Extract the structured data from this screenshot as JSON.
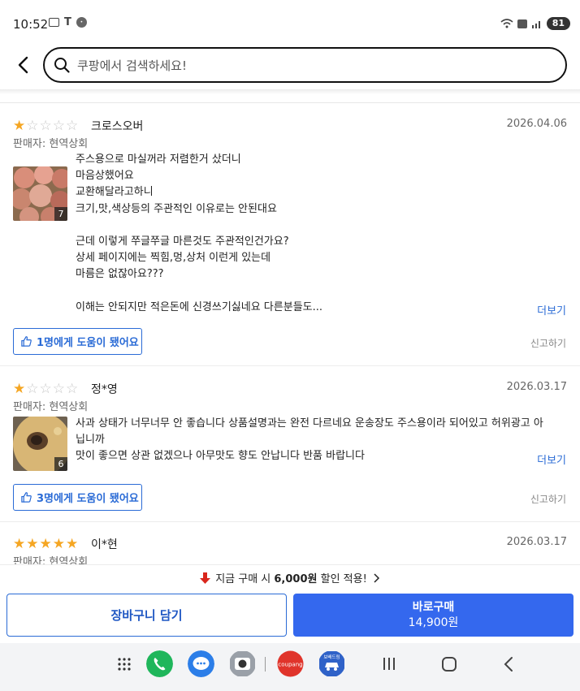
{
  "status_bar": {
    "time": "10:52",
    "battery": "81",
    "network": "LTE"
  },
  "search": {
    "placeholder": "쿠팡에서 검색하세요!",
    "value": ""
  },
  "reviews": [
    {
      "rating": 1,
      "author": "크로스오버",
      "date": "2026.04.06",
      "seller": "판매자: 현역상회",
      "photo_count": "7",
      "text": "주스용으로 마실꺼라 저렴한거 샀더니\n마음상했어요\n교환해달라고하니\n크기,맛,색상등의 주관적인 이유로는 안된대요\n\n근데 이렇게 쭈글쭈글 마른것도 주관적인건가요?\n상세 페이지에는 찍힘,멍,상처 이런게 있는데\n마름은 없잖아요???\n\n이해는 안되지만 적은돈에 신경쓰기싫네요 다른분들도...",
      "more_label": "더보기",
      "helpful_label": "1명에게 도움이 됐어요",
      "report_label": "신고하기"
    },
    {
      "rating": 1,
      "author": "정*영",
      "date": "2026.03.17",
      "seller": "판매자: 현역상회",
      "photo_count": "6",
      "text": "사과 상태가 너무너무 안 좋습니다 상품설명과는 완전 다르네요 운송장도 주스용이라 되어있고 허위광고 아\n닙니까\n맛이 좋으면 상관 없겠으나 아무맛도 향도 안납니다 반품 바랍니다",
      "more_label": "더보기",
      "helpful_label": "3명에게 도움이 됐어요",
      "report_label": "신고하기"
    },
    {
      "rating": 5,
      "author": "이*현",
      "date": "2026.03.17",
      "seller": "판매자: 현역상회"
    }
  ],
  "purchase": {
    "discount_prefix": "지금 구매 시 ",
    "discount_amount": "6,000원",
    "discount_suffix": " 할인 적용!",
    "cart_label": "장바구니 담기",
    "buy_label": "바로구매",
    "buy_price": "14,900원"
  },
  "dock": {
    "apps": [
      "apps-grid",
      "phone",
      "messages",
      "camera",
      "coupang",
      "car-app"
    ],
    "coupang_label": "coupang",
    "car_app_label": "보배드림"
  },
  "colors": {
    "accent": "#2a6bd6",
    "buy_button": "#3468ee",
    "star_on": "#f5a623",
    "star_off": "#c8c8c8"
  }
}
